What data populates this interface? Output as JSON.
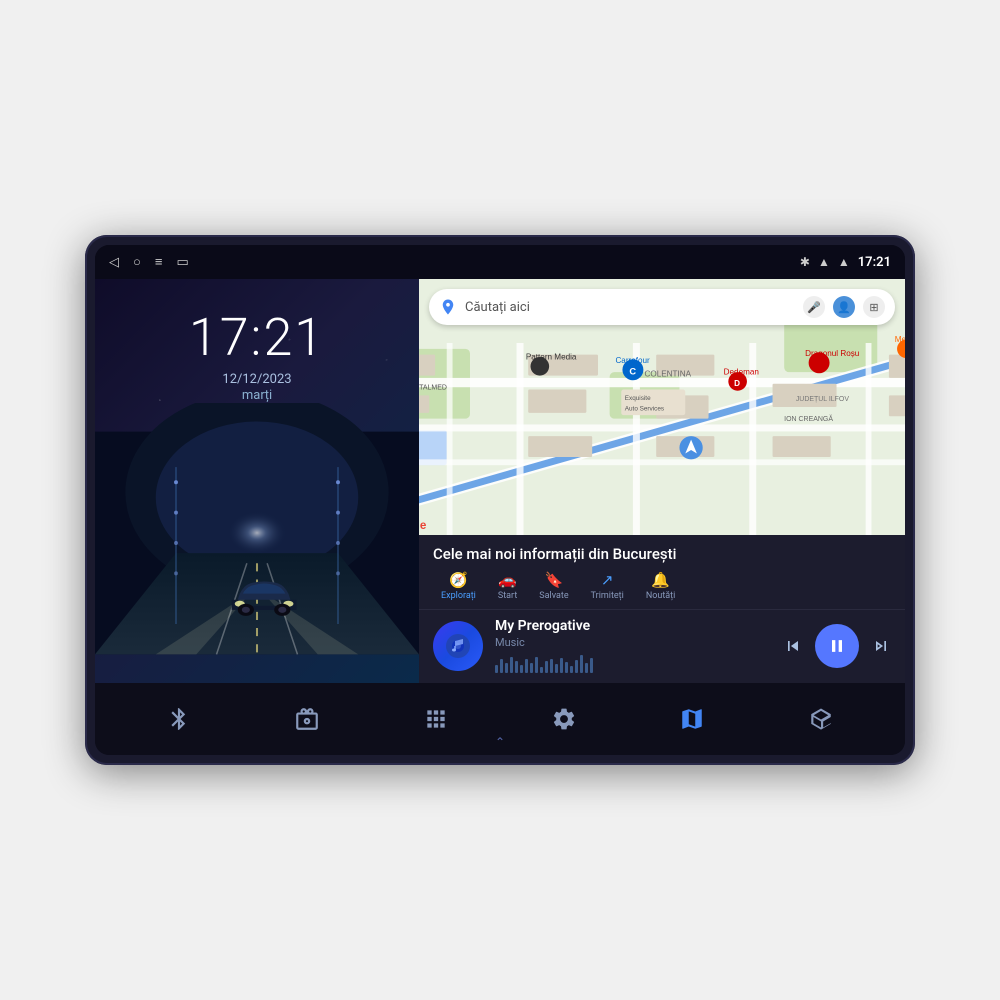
{
  "device": {
    "status_bar": {
      "left_icons": [
        "back-arrow",
        "circle",
        "menu",
        "square"
      ],
      "right_icons": [
        "bluetooth",
        "wifi",
        "signal"
      ],
      "time": "17:21"
    },
    "left_panel": {
      "clock": {
        "time": "17:21",
        "date": "12/12/2023",
        "day": "marți"
      }
    },
    "right_panel": {
      "map": {
        "search_placeholder": "Căutați aici",
        "info_title": "Cele mai noi informații din București",
        "tabs": [
          {
            "label": "Explorați",
            "icon": "compass"
          },
          {
            "label": "Start",
            "icon": "directions"
          },
          {
            "label": "Salvate",
            "icon": "bookmark"
          },
          {
            "label": "Trimiteți",
            "icon": "share"
          },
          {
            "label": "Noutăți",
            "icon": "bell"
          }
        ]
      },
      "music": {
        "title": "My Prerogative",
        "subtitle": "Music",
        "controls": {
          "prev": "⏮",
          "play": "⏸",
          "next": "⏭"
        }
      }
    },
    "bottom_nav": {
      "items": [
        {
          "name": "bluetooth",
          "icon": "⌬"
        },
        {
          "name": "radio",
          "icon": "◉"
        },
        {
          "name": "apps",
          "icon": "⊞"
        },
        {
          "name": "settings",
          "icon": "⚙"
        },
        {
          "name": "maps",
          "icon": "◈"
        },
        {
          "name": "box",
          "icon": "◇"
        }
      ]
    }
  }
}
